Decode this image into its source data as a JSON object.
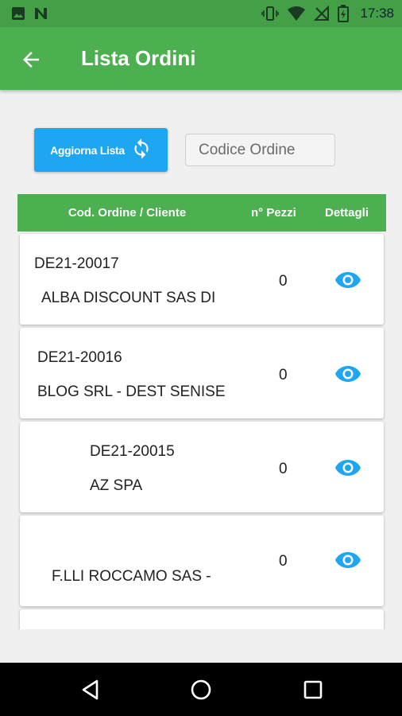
{
  "status_bar": {
    "time": "17:38",
    "icons": [
      "image-icon",
      "n-notification-icon",
      "vibrate-icon",
      "wifi-icon",
      "no-signal-icon",
      "battery-icon"
    ]
  },
  "app_bar": {
    "title": "Lista Ordini",
    "back_icon": "arrow-left-icon"
  },
  "controls": {
    "refresh_label": "Aggiorna Lista",
    "refresh_icon": "sync-icon",
    "search_placeholder": "Codice Ordine",
    "search_value": ""
  },
  "table": {
    "headers": {
      "code_client": "Cod. Ordine / Cliente",
      "pieces": "n° Pezzi",
      "details": "Dettagli"
    },
    "rows": [
      {
        "code": "DE21-20017",
        "client": "ALBA DISCOUNT SAS DI",
        "pieces": "0",
        "details_icon": "eye-icon"
      },
      {
        "code": "DE21-20016",
        "client": "BLOG SRL - DEST SENISE",
        "pieces": "0",
        "details_icon": "eye-icon"
      },
      {
        "code": "DE21-20015",
        "client": "AZ SPA",
        "pieces": "0",
        "details_icon": "eye-icon"
      },
      {
        "code": "",
        "client": "F.LLI ROCCAMO SAS -",
        "pieces": "0",
        "details_icon": "eye-icon"
      }
    ]
  },
  "nav_bar": {
    "icons": [
      "back-triangle-icon",
      "home-circle-icon",
      "recents-square-icon"
    ]
  },
  "colors": {
    "status_bar": "#43a047",
    "app_bar": "#4caf50",
    "table_header": "#4caf50",
    "button": "#1ea7f0",
    "eye_icon": "#1ea7f0",
    "background": "#f0f0f0"
  }
}
